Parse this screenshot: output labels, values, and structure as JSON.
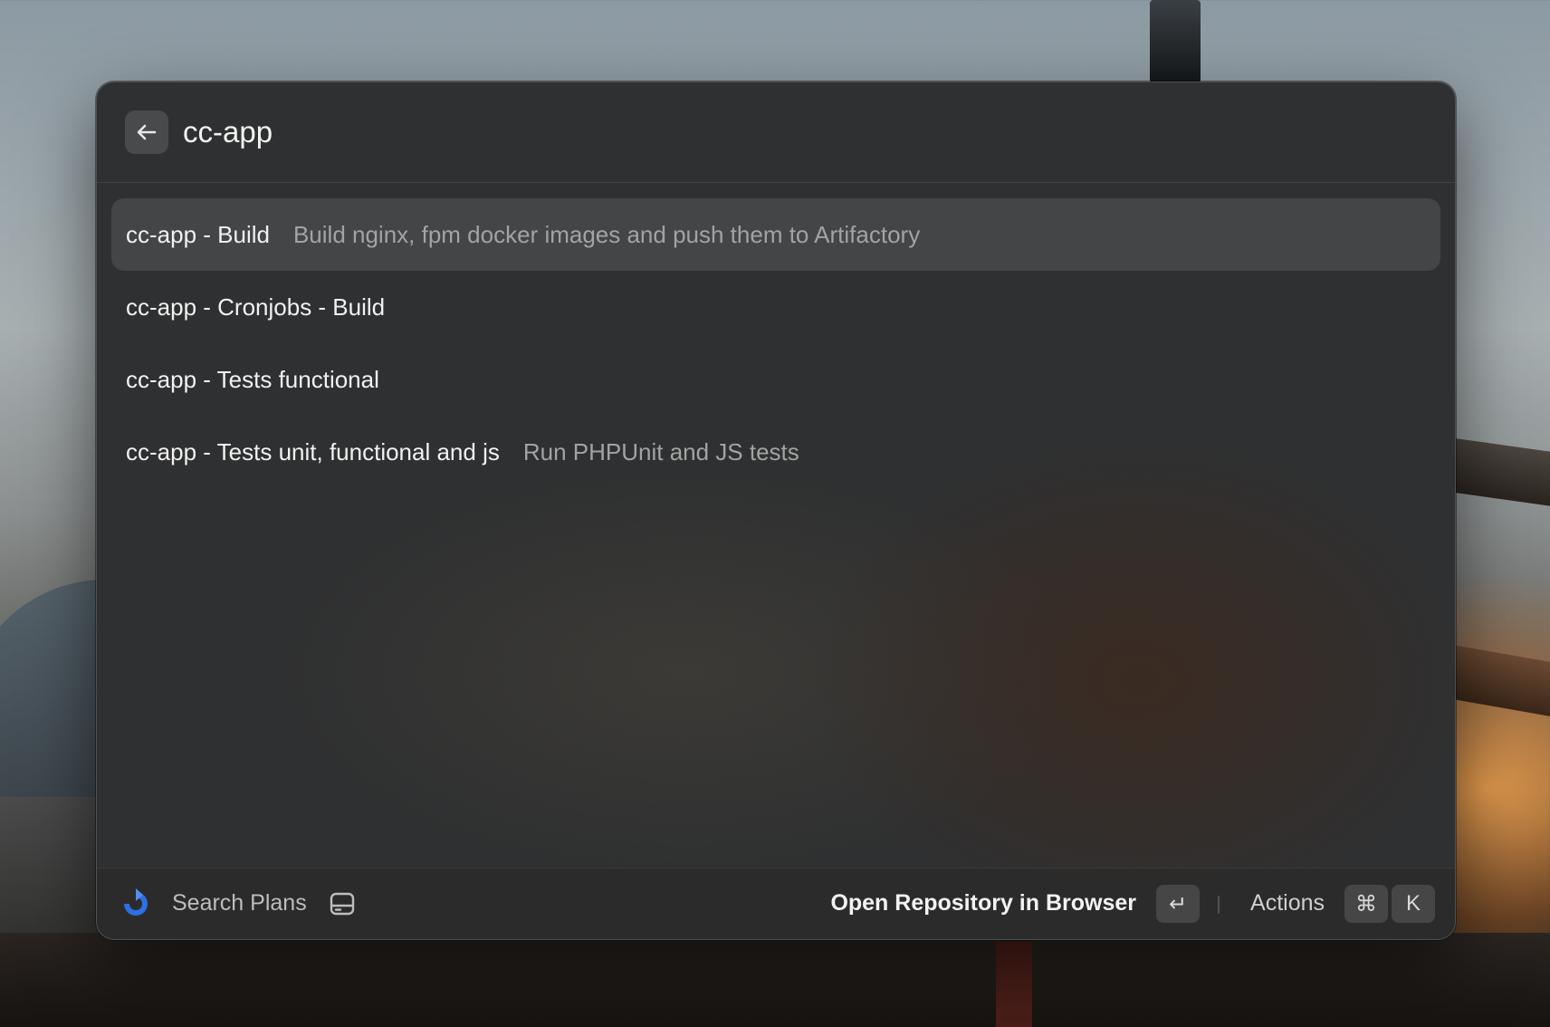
{
  "search": {
    "value": "cc-app"
  },
  "results": [
    {
      "title": "cc-app - Build",
      "subtitle": "Build nginx, fpm docker images and push them to Artifactory",
      "selected": true
    },
    {
      "title": "cc-app - Cronjobs - Build",
      "subtitle": "",
      "selected": false
    },
    {
      "title": "cc-app - Tests functional",
      "subtitle": "",
      "selected": false
    },
    {
      "title": "cc-app - Tests unit, functional and js",
      "subtitle": "Run PHPUnit and JS tests",
      "selected": false
    }
  ],
  "footer": {
    "app_icon": "bamboo-logo-icon",
    "command_title": "Search Plans",
    "command_icon": "drive-icon",
    "primary_action": "Open Repository in Browser",
    "primary_key": "↵",
    "actions_label": "Actions",
    "actions_keys": [
      "⌘",
      "K"
    ]
  },
  "colors": {
    "accent": "#2f6fe0",
    "window_bg": "#2f3031",
    "selected_row": "#3e3f40"
  }
}
